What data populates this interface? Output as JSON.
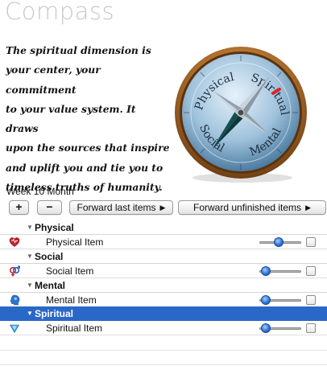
{
  "app": {
    "title": "Compass"
  },
  "quote": {
    "lines": [
      "The spiritual dimension is",
      "your center, your commitment",
      "to your value system. It draws",
      "upon the sources that inspire",
      "and uplift you and tie you to",
      "timeless truths of humanity."
    ]
  },
  "compass": {
    "labels": {
      "physical": "Physical",
      "spiritual": "Spiritual",
      "social": "Social",
      "mental": "Mental"
    }
  },
  "period": {
    "label": "Week 10 Month"
  },
  "toolbar": {
    "add_label": "+",
    "remove_label": "−",
    "forward_last_label": "Forward last items",
    "forward_unfinished_label": "Forward unfinished items",
    "arrow_glyph": "▶"
  },
  "outline": {
    "groups": [
      {
        "name": "Physical",
        "icon": "heart-icon",
        "item": "Physical Item",
        "progress": 0.45,
        "done": false,
        "selected": false
      },
      {
        "name": "Social",
        "icon": "gender-symbols-icon",
        "item": "Social Item",
        "progress": 0.05,
        "done": false,
        "selected": false
      },
      {
        "name": "Mental",
        "icon": "head-icon",
        "item": "Mental Item",
        "progress": 0.05,
        "done": false,
        "selected": false
      },
      {
        "name": "Spiritual",
        "icon": "spirit-icon",
        "item": "Spiritual Item",
        "progress": 0.05,
        "done": false,
        "selected": true
      }
    ]
  },
  "colors": {
    "selection": "#2a68c8",
    "title": "#c8c8c8",
    "slider_knob": "#2a6fd6"
  }
}
